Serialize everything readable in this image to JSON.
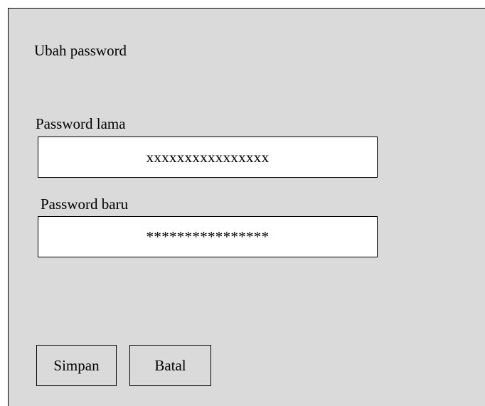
{
  "dialog": {
    "title": "Ubah password",
    "old_password": {
      "label": "Password lama",
      "value": "xxxxxxxxxxxxxxxx"
    },
    "new_password": {
      "label": "Password baru",
      "value": "****************"
    },
    "buttons": {
      "save_label": "Simpan",
      "cancel_label": "Batal"
    },
    "colors": {
      "panel_background": "#dadada",
      "field_background": "#ffffff",
      "border": "#000000"
    }
  }
}
